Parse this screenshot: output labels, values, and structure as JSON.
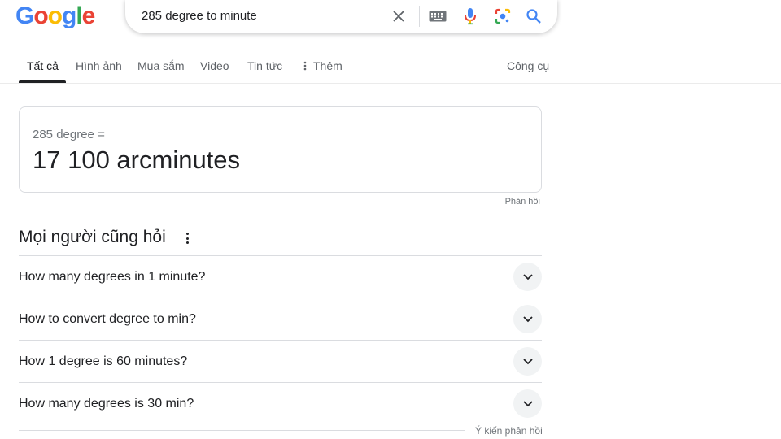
{
  "logo": {
    "letters": [
      "G",
      "o",
      "o",
      "g",
      "l",
      "e"
    ],
    "colors": [
      "#4285F4",
      "#EA4335",
      "#FBBC05",
      "#4285F4",
      "#34A853",
      "#EA4335"
    ]
  },
  "search": {
    "query": "285 degree to minute"
  },
  "icons": {
    "clear": "close-icon",
    "keyboard": "keyboard-icon",
    "mic": "mic-icon",
    "lens": "lens-icon",
    "search": "search-icon",
    "more": "more-vert-icon",
    "chevron": "chevron-down-icon"
  },
  "tabs": [
    {
      "label": "Tất cả"
    },
    {
      "label": "Hình ảnh"
    },
    {
      "label": "Mua sắm"
    },
    {
      "label": "Video"
    },
    {
      "label": "Tin tức"
    },
    {
      "label": "Thêm"
    }
  ],
  "tools_label": "Công cụ",
  "converter": {
    "input": "285 degree =",
    "result": "17 100 arcminutes",
    "feedback": "Phản hồi"
  },
  "people_also_ask": {
    "title": "Mọi người cũng hỏi",
    "questions": [
      "How many degrees in 1 minute?",
      "How to convert degree to min?",
      "How 1 degree is 60 minutes?",
      "How many degrees is 30 min?"
    ],
    "feedback": "Ý kiến phản hồi"
  }
}
